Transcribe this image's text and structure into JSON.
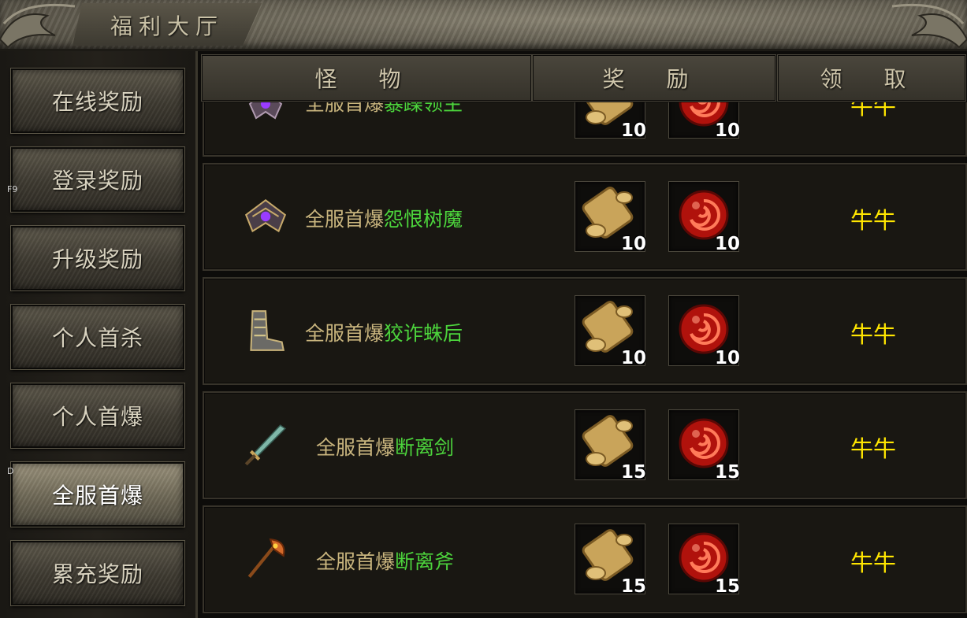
{
  "window": {
    "title": "福利大厅"
  },
  "nav": {
    "items": [
      {
        "label": "在线奖励"
      },
      {
        "label": "登录奖励"
      },
      {
        "label": "升级奖励"
      },
      {
        "label": "个人首杀"
      },
      {
        "label": "个人首爆"
      },
      {
        "label": "全服首爆",
        "active": true
      },
      {
        "label": "累充奖励"
      }
    ],
    "hotkeys": {
      "f9": "F9",
      "d": "D"
    }
  },
  "table": {
    "headers": {
      "monster": "怪 物",
      "reward": "奖 励",
      "claim": "领 取"
    },
    "rows": [
      {
        "prefix": "全服首爆",
        "name": "暴躁领主",
        "scroll_count": "10",
        "orb_count": "10",
        "claim": "牛牛",
        "icon": "wing-helmet-icon"
      },
      {
        "prefix": "全服首爆",
        "name": "怨恨树魔",
        "scroll_count": "10",
        "orb_count": "10",
        "claim": "牛牛",
        "icon": "wing-helmet-icon"
      },
      {
        "prefix": "全服首爆",
        "name": "狡诈蛛后",
        "scroll_count": "10",
        "orb_count": "10",
        "claim": "牛牛",
        "icon": "boots-icon"
      },
      {
        "prefix": "全服首爆",
        "name": "断离剑",
        "scroll_count": "15",
        "orb_count": "15",
        "claim": "牛牛",
        "icon": "sword-icon"
      },
      {
        "prefix": "全服首爆",
        "name": "断离斧",
        "scroll_count": "15",
        "orb_count": "15",
        "claim": "牛牛",
        "icon": "axe-icon"
      }
    ]
  },
  "colors": {
    "prefix": "#c9b57e",
    "monster_name": "#4cd43c",
    "claim": "#ffe600"
  }
}
